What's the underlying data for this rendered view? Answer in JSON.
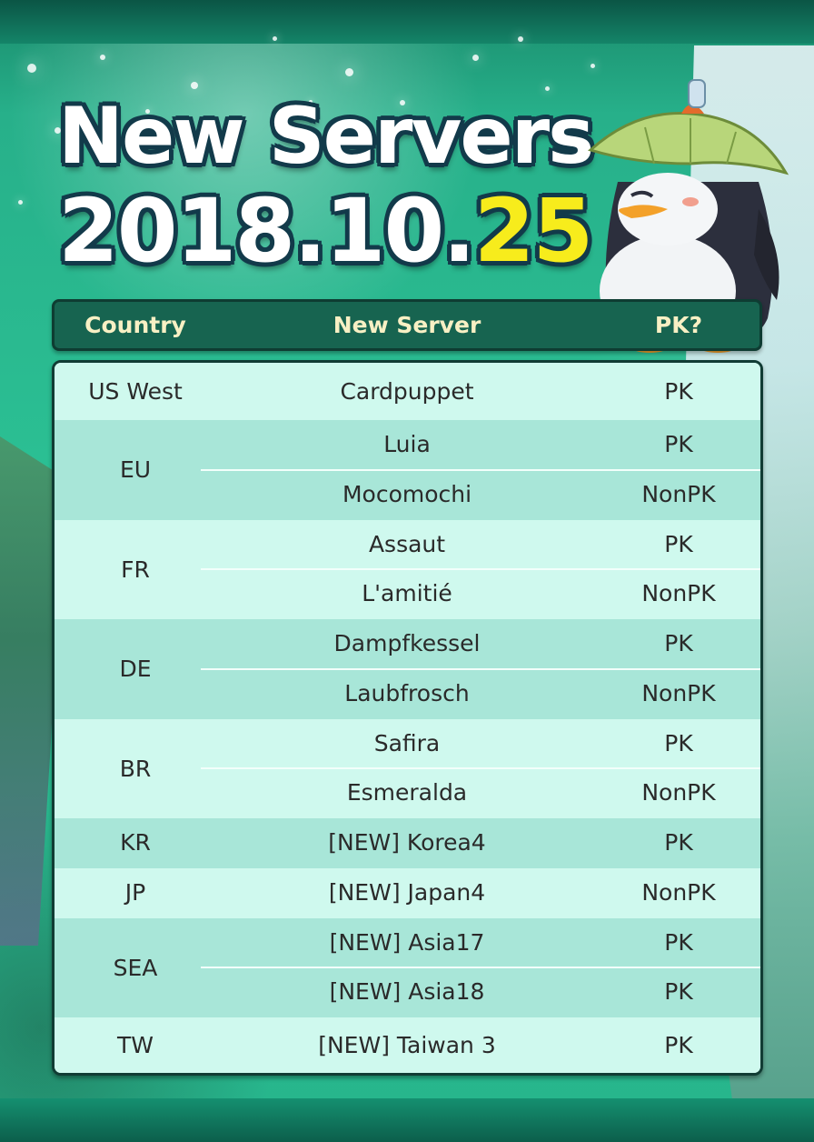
{
  "title": {
    "line1": "New Servers",
    "date_main": "2018.10.",
    "date_day": "25"
  },
  "colors": {
    "title_text": "#ffffff",
    "title_outline": "#123a4a",
    "date_highlight": "#f7ec1c",
    "header_bg": "#176450",
    "header_text": "#f8f0c4",
    "row_light": "#cff9ee",
    "row_dark": "#a8e6d8"
  },
  "table": {
    "headers": {
      "country": "Country",
      "server": "New Server",
      "pk": "PK?"
    },
    "groups": [
      {
        "country": "US West",
        "servers": [
          {
            "name": "Cardpuppet",
            "pk": "PK"
          }
        ]
      },
      {
        "country": "EU",
        "servers": [
          {
            "name": "Luia",
            "pk": "PK"
          },
          {
            "name": "Mocomochi",
            "pk": "NonPK"
          }
        ]
      },
      {
        "country": "FR",
        "servers": [
          {
            "name": "Assaut",
            "pk": "PK"
          },
          {
            "name": "L'amitié",
            "pk": "NonPK"
          }
        ]
      },
      {
        "country": "DE",
        "servers": [
          {
            "name": "Dampfkessel",
            "pk": "PK"
          },
          {
            "name": "Laubfrosch",
            "pk": "NonPK"
          }
        ]
      },
      {
        "country": "BR",
        "servers": [
          {
            "name": "Safira",
            "pk": "PK"
          },
          {
            "name": "Esmeralda",
            "pk": "NonPK"
          }
        ]
      },
      {
        "country": "KR",
        "servers": [
          {
            "name": "[NEW] Korea4",
            "pk": "PK"
          }
        ]
      },
      {
        "country": "JP",
        "servers": [
          {
            "name": "[NEW] Japan4",
            "pk": "NonPK"
          }
        ]
      },
      {
        "country": "SEA",
        "servers": [
          {
            "name": "[NEW] Asia17",
            "pk": "PK"
          },
          {
            "name": "[NEW] Asia18",
            "pk": "PK"
          }
        ]
      },
      {
        "country": "TW",
        "servers": [
          {
            "name": "[NEW] Taiwan 3",
            "pk": "PK"
          }
        ]
      }
    ]
  },
  "decor": {
    "mascot": "penguin-with-leaf-hat-icon"
  }
}
